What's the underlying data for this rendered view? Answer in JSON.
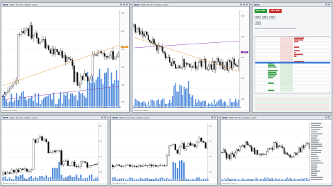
{
  "colors": {
    "up": "#2b2b2b",
    "down": "#111111",
    "vol": "#3b7dd8",
    "ma_orange": "#e69a2e",
    "ma_purple": "#8e3fb3",
    "buy": "#2e9a3a",
    "sell": "#c8302f"
  },
  "chart1": {
    "symbol": "WNU",
    "title": "WNU 5 D 1m (Heikin Ashi)",
    "footer": "Drawing set: Default",
    "y_ticks": [
      "4.50",
      "4.00",
      "3.50",
      "3.00",
      "2.50",
      "2.00"
    ],
    "x_ticks": [
      "9:30",
      "10:00",
      "10:30",
      "11:00",
      "11:30"
    ],
    "price_tag": "2.94"
  },
  "chart2": {
    "symbol": "WNU",
    "title": "WNU 5 D 1m (Heikin Ashi)",
    "footer": "Drawing set: Default",
    "y_ticks": [
      "3.40",
      "3.20",
      "3.00",
      "2.80",
      "2.60"
    ],
    "x_ticks": [
      "9:45",
      "10:00",
      "10:15",
      "10:30",
      "10:45"
    ],
    "price_tag": "2.94"
  },
  "side": {
    "symbol": "WNU",
    "buy_label": "BUY MKT",
    "sell_label": "SELL MKT",
    "last": "2.94",
    "qty": "100",
    "order_type": "LMT",
    "tif": "DAY"
  },
  "chart3": {
    "symbol": "WNU",
    "title": "WNU 5 D 1m (Heikin Ashi)",
    "footer": "Drawing set: Default",
    "y_ticks": [
      "4.0",
      "3.5",
      "3.0",
      "2.5"
    ],
    "x_ticks": [
      "10:00",
      "11:00"
    ]
  },
  "chart4": {
    "symbol": "WNU",
    "title": "WNU 10 D 15m (Heikin Ashi)",
    "footer": "Drawing set: Default",
    "y_ticks": [
      "4.0",
      "3.5",
      "3.0",
      "2.5"
    ],
    "x_ticks": [
      "Mon",
      "Tue",
      "Wed"
    ]
  },
  "chart5": {
    "symbol": "WNU",
    "title": "WNU 5 D 5m (Heikin Ashi)",
    "footer": "Drawing set: Default",
    "x_ticks": [
      "Mon",
      "Tue",
      "Wed",
      "Thu"
    ]
  }
}
